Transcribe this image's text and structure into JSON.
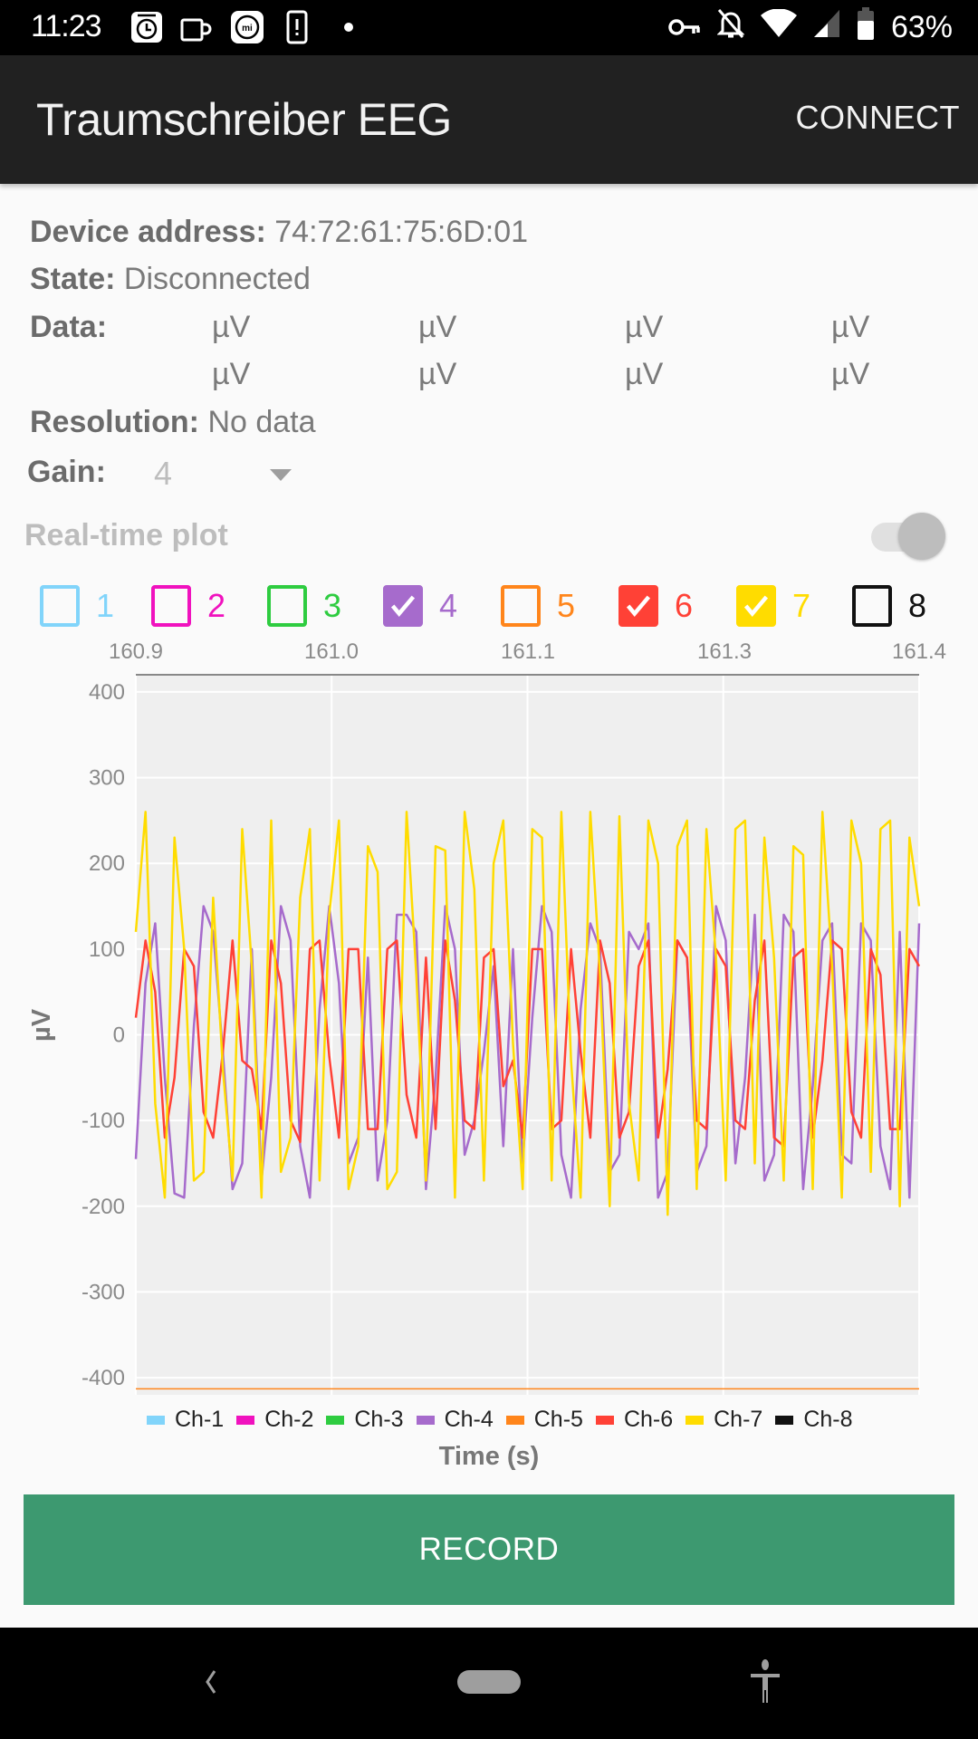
{
  "status_bar": {
    "time": "11:23",
    "left_icons": [
      "alarm-clock-icon",
      "cup-icon",
      "mi-fit-icon",
      "phone-alert-icon",
      "dot-icon"
    ],
    "right_icons": [
      "vpn-key-icon",
      "notifications-off-icon",
      "wifi-icon",
      "cell-signal-icon",
      "battery-icon"
    ],
    "battery": "63%"
  },
  "app_bar": {
    "title": "Traumschreiber EEG",
    "connect_label": "CONNECT"
  },
  "info": {
    "device_address_label": "Device address:",
    "device_address": "74:72:61:75:6D:01",
    "state_label": "State:",
    "state": "Disconnected",
    "data_label": "Data:",
    "data_units": [
      "µV",
      "µV",
      "µV",
      "µV",
      "µV",
      "µV",
      "µV",
      "µV"
    ],
    "resolution_label": "Resolution:",
    "resolution": "No data",
    "gain_label": "Gain:",
    "gain_value": "4"
  },
  "realtime": {
    "label": "Real-time plot",
    "enabled": false
  },
  "channels": [
    {
      "num": "1",
      "color": "#81d4fa",
      "checked": false
    },
    {
      "num": "2",
      "color": "#f012be",
      "checked": false
    },
    {
      "num": "3",
      "color": "#2ecc40",
      "checked": false
    },
    {
      "num": "4",
      "color": "#a66bcc",
      "checked": true
    },
    {
      "num": "5",
      "color": "#ff851b",
      "checked": false
    },
    {
      "num": "6",
      "color": "#ff4136",
      "checked": true
    },
    {
      "num": "7",
      "color": "#ffdc00",
      "checked": true
    },
    {
      "num": "8",
      "color": "#111111",
      "checked": false
    }
  ],
  "chart_data": {
    "type": "line",
    "title": "",
    "xlabel": "Time (s)",
    "ylabel": "µV",
    "x_tick_labels": [
      "160.9",
      "161.0",
      "161.1",
      "161.3",
      "161.4"
    ],
    "x_axis_position": "top",
    "ylim": [
      -420,
      420
    ],
    "y_ticks": [
      400,
      300,
      200,
      100,
      0,
      -100,
      -200,
      -300,
      -400
    ],
    "grid": true,
    "legend_position": "bottom",
    "legend": [
      "Ch-1",
      "Ch-2",
      "Ch-3",
      "Ch-4",
      "Ch-5",
      "Ch-6",
      "Ch-7",
      "Ch-8"
    ],
    "x_range": [
      0,
      1
    ],
    "series": [
      {
        "name": "Ch-5",
        "color": "#ff851b",
        "values": [
          -413,
          -413
        ]
      },
      {
        "name": "Ch-4",
        "color": "#a66bcc",
        "values": [
          -145,
          60,
          130,
          -50,
          -185,
          -190,
          10,
          150,
          120,
          -20,
          -180,
          -150,
          100,
          -170,
          -50,
          150,
          110,
          -130,
          -190,
          30,
          150,
          60,
          -150,
          -120,
          90,
          -170,
          -100,
          140,
          140,
          120,
          -180,
          -50,
          150,
          100,
          -140,
          -100,
          -20,
          80,
          -130,
          100,
          -150,
          20,
          150,
          120,
          -140,
          -190,
          30,
          130,
          100,
          -160,
          -140,
          120,
          100,
          130,
          -190,
          -160,
          110,
          90,
          -160,
          -130,
          150,
          110,
          -150,
          -50,
          140,
          -170,
          -140,
          140,
          120,
          -180,
          -60,
          110,
          130,
          -140,
          -150,
          130,
          110,
          -130,
          -180,
          120,
          -190,
          130
        ]
      },
      {
        "name": "Ch-6",
        "color": "#ff4136",
        "values": [
          20,
          110,
          50,
          -120,
          -50,
          100,
          80,
          -90,
          -120,
          -20,
          110,
          -30,
          -40,
          -110,
          110,
          60,
          -100,
          -125,
          100,
          110,
          -25,
          -120,
          100,
          100,
          -110,
          -110,
          100,
          110,
          -70,
          -120,
          90,
          -110,
          110,
          40,
          -100,
          -110,
          90,
          100,
          -60,
          -30,
          -120,
          100,
          100,
          -110,
          -100,
          100,
          -20,
          -120,
          110,
          60,
          -120,
          -90,
          80,
          110,
          -120,
          -40,
          110,
          90,
          -100,
          -110,
          100,
          80,
          -100,
          -110,
          40,
          110,
          -120,
          -130,
          90,
          100,
          -120,
          -30,
          110,
          100,
          -90,
          -120,
          100,
          70,
          -110,
          -110,
          100,
          80
        ]
      },
      {
        "name": "Ch-7",
        "color": "#ffdc00",
        "values": [
          120,
          260,
          -80,
          -190,
          230,
          100,
          -170,
          -160,
          160,
          -40,
          -170,
          240,
          80,
          -190,
          250,
          -160,
          -120,
          160,
          240,
          -170,
          140,
          250,
          -180,
          -130,
          220,
          190,
          -180,
          -160,
          260,
          70,
          -170,
          220,
          215,
          -190,
          260,
          170,
          -170,
          200,
          250,
          -10,
          -180,
          240,
          230,
          -170,
          260,
          -30,
          -190,
          260,
          70,
          -200,
          255,
          -80,
          -170,
          250,
          200,
          -210,
          220,
          250,
          -180,
          240,
          90,
          -170,
          240,
          250,
          -150,
          230,
          90,
          -170,
          220,
          210,
          -180,
          260,
          80,
          -190,
          250,
          200,
          -160,
          240,
          250,
          -200,
          230,
          150
        ]
      }
    ]
  },
  "record_label": "RECORD",
  "nav_bar": {
    "back_icon": "back-chevron-icon",
    "home_icon": "home-pill-icon",
    "accessibility_icon": "accessibility-icon"
  }
}
